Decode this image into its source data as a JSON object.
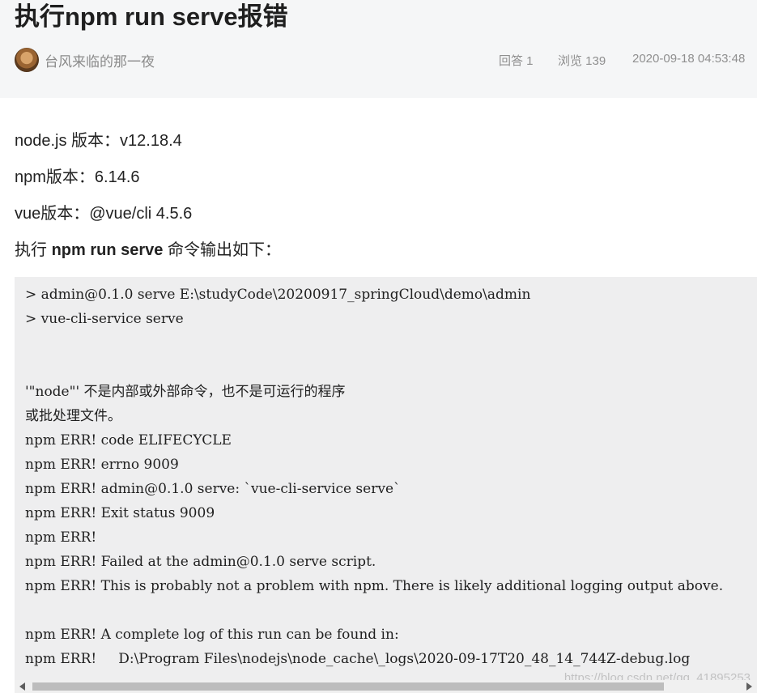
{
  "question": {
    "title": "执行npm run serve报错",
    "author": "台风来临的那一夜",
    "answers": "回答 1",
    "views": "浏览 139",
    "date": "2020-09-18 04:53:48",
    "avatar_icon": "user-avatar-icon"
  },
  "body": {
    "node_version": "node.js 版本：v12.18.4",
    "npm_version": "npm版本：6.14.6",
    "vue_version": "vue版本：@vue/cli 4.5.6",
    "exec_prefix": "执行 ",
    "exec_command": "npm run serve",
    "exec_suffix": " 命令输出如下："
  },
  "code": {
    "lines": [
      "> admin@0.1.0 serve E:\\studyCode\\20200917_springCloud\\demo\\admin",
      "> vue-cli-service serve",
      "",
      "",
      "'\"node\"' 不是内部或外部命令，也不是可运行的程序",
      "或批处理文件。",
      "npm ERR! code ELIFECYCLE",
      "npm ERR! errno 9009",
      "npm ERR! admin@0.1.0 serve: `vue-cli-service serve`",
      "npm ERR! Exit status 9009",
      "npm ERR!",
      "npm ERR! Failed at the admin@0.1.0 serve script.",
      "npm ERR! This is probably not a problem with npm. There is likely additional logging output above.",
      "",
      "npm ERR! A complete log of this run can be found in:",
      "npm ERR!     D:\\Program Files\\nodejs\\node_cache\\_logs\\2020-09-17T20_48_14_744Z-debug.log"
    ]
  },
  "watermark": "https://blog.csdn.net/qq_41895253",
  "colors": {
    "header_bg": "#f5f6f7",
    "code_bg": "#eeeeef",
    "muted_text": "#8f8f8f"
  }
}
